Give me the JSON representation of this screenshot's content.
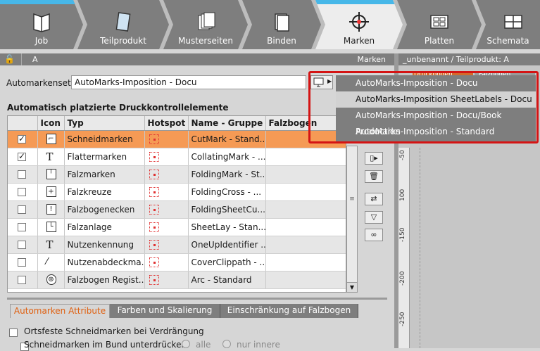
{
  "workflow": {
    "steps": [
      {
        "label": "Job",
        "icon": "book-icon"
      },
      {
        "label": "Teilprodukt",
        "icon": "sheet-icon"
      },
      {
        "label": "Musterseiten",
        "icon": "pages-icon"
      },
      {
        "label": "Binden",
        "icon": "binding-icon"
      },
      {
        "label": "Marken",
        "icon": "registration-mark-icon",
        "active": true
      },
      {
        "label": "Platten",
        "icon": "plates-icon"
      },
      {
        "label": "Schemata",
        "icon": "schemes-icon"
      }
    ],
    "accent": "#47b7e8"
  },
  "panel_left": {
    "header_left": "A",
    "header_right": "Marken"
  },
  "panel_right": {
    "header": "_unbenannt / Teilprodukt: A"
  },
  "automarkenset": {
    "label": "Automarkenset:",
    "value": "AutoMarks-Imposition - Docu",
    "options": [
      "AutoMarks-Imposition - Docu",
      "AutoMarks-Imposition SheetLabels - Docu",
      "AutoMarks-Imposition - Docu/Book Production",
      "AutoMarks-Imposition - Standard"
    ],
    "highlighted_option": 1
  },
  "section_title": "Automatisch platzierte Druckkontrollelemente",
  "table": {
    "columns": [
      "",
      "Icon",
      "Typ",
      "Hotspot",
      "Name - Gruppe",
      "Falzbogen"
    ],
    "rows": [
      {
        "checked": true,
        "icon": "cut-mark-icon",
        "typ": "Schneidmarken",
        "name": "CutMark - Stand...",
        "falzbogen": "",
        "selected": true
      },
      {
        "checked": true,
        "icon": "text-t-icon",
        "typ": "Flattermarken",
        "name": "CollatingMark - ...",
        "falzbogen": ""
      },
      {
        "checked": false,
        "icon": "fold-mark-icon",
        "typ": "Falzmarken",
        "name": "FoldingMark - St...",
        "falzbogen": ""
      },
      {
        "checked": false,
        "icon": "fold-cross-icon",
        "typ": "Falzkreuze",
        "name": "FoldingCross - ...",
        "falzbogen": ""
      },
      {
        "checked": false,
        "icon": "sheet-corner-icon",
        "typ": "Falzbogenecken",
        "name": "FoldingSheetCu...",
        "falzbogen": ""
      },
      {
        "checked": false,
        "icon": "sheet-lay-icon",
        "typ": "Falzanlage",
        "name": "SheetLay - Stan...",
        "falzbogen": ""
      },
      {
        "checked": false,
        "icon": "text-t-icon",
        "typ": "Nutzenkennung",
        "name": "OneUpIdentifier ...",
        "falzbogen": ""
      },
      {
        "checked": false,
        "icon": "wand-icon",
        "typ": "Nutzenabdeckma...",
        "name": "CoverClippath - ...",
        "falzbogen": ""
      },
      {
        "checked": false,
        "icon": "register-mark-icon",
        "typ": "Falzbogen Regist...",
        "name": "Arc - Standard",
        "falzbogen": ""
      }
    ]
  },
  "tabs": [
    "Automarken Attribute",
    "Farben und Skalierung",
    "Einschränkung auf Falzbogen"
  ],
  "options": {
    "opt1": "Ortsfeste Schneidmarken bei Verdrängung",
    "opt2": "Schneidmarken im Bund unterdrücken",
    "radio1": "alle",
    "radio2": "nur innere"
  },
  "ruler": {
    "labels": [
      "-50",
      "100",
      "-150",
      "-200",
      "-250"
    ]
  },
  "preview_tabs": [
    "Druckbogen",
    "Falzbogen"
  ]
}
